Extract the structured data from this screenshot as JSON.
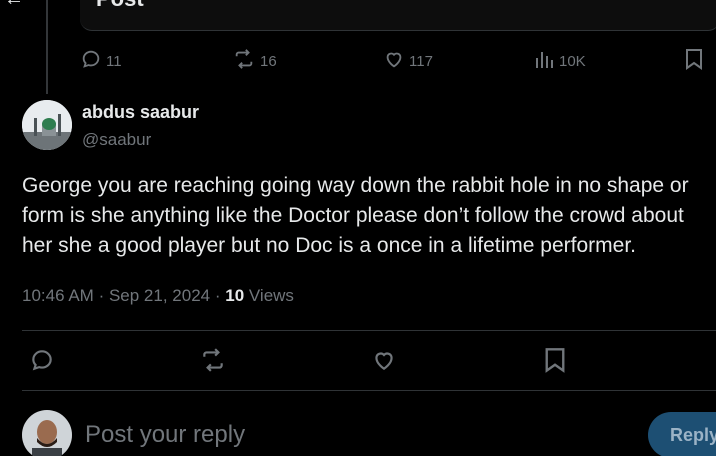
{
  "header": {
    "title": "Post",
    "back_icon": "arrow-left-icon"
  },
  "parent_actions": {
    "replies": "11",
    "reposts": "16",
    "likes": "117",
    "views": "10K"
  },
  "tweet": {
    "author_name": "abdus saabur",
    "author_handle": "@saabur",
    "text_lines": [
      "George you are reaching going way down the rabbit hole in no shape or",
      "form is she anything like the Doctor please don’t follow the crowd about",
      "her she a good player but no Doc is a once in a lifetime performer."
    ],
    "time": "10:46 AM",
    "date": "Sep 21, 2024",
    "views_count": "10",
    "views_label": "Views"
  },
  "tweet_actions": {
    "icons": [
      "reply-icon",
      "repost-icon",
      "like-icon",
      "bookmark-icon"
    ]
  },
  "composer": {
    "placeholder": "Post your reply",
    "reply_label": "Reply"
  },
  "colors": {
    "background": "#000000",
    "text": "#e7e9ea",
    "secondary": "#71767b",
    "divider": "#2f3336",
    "reply_button": "#1d4f73"
  }
}
